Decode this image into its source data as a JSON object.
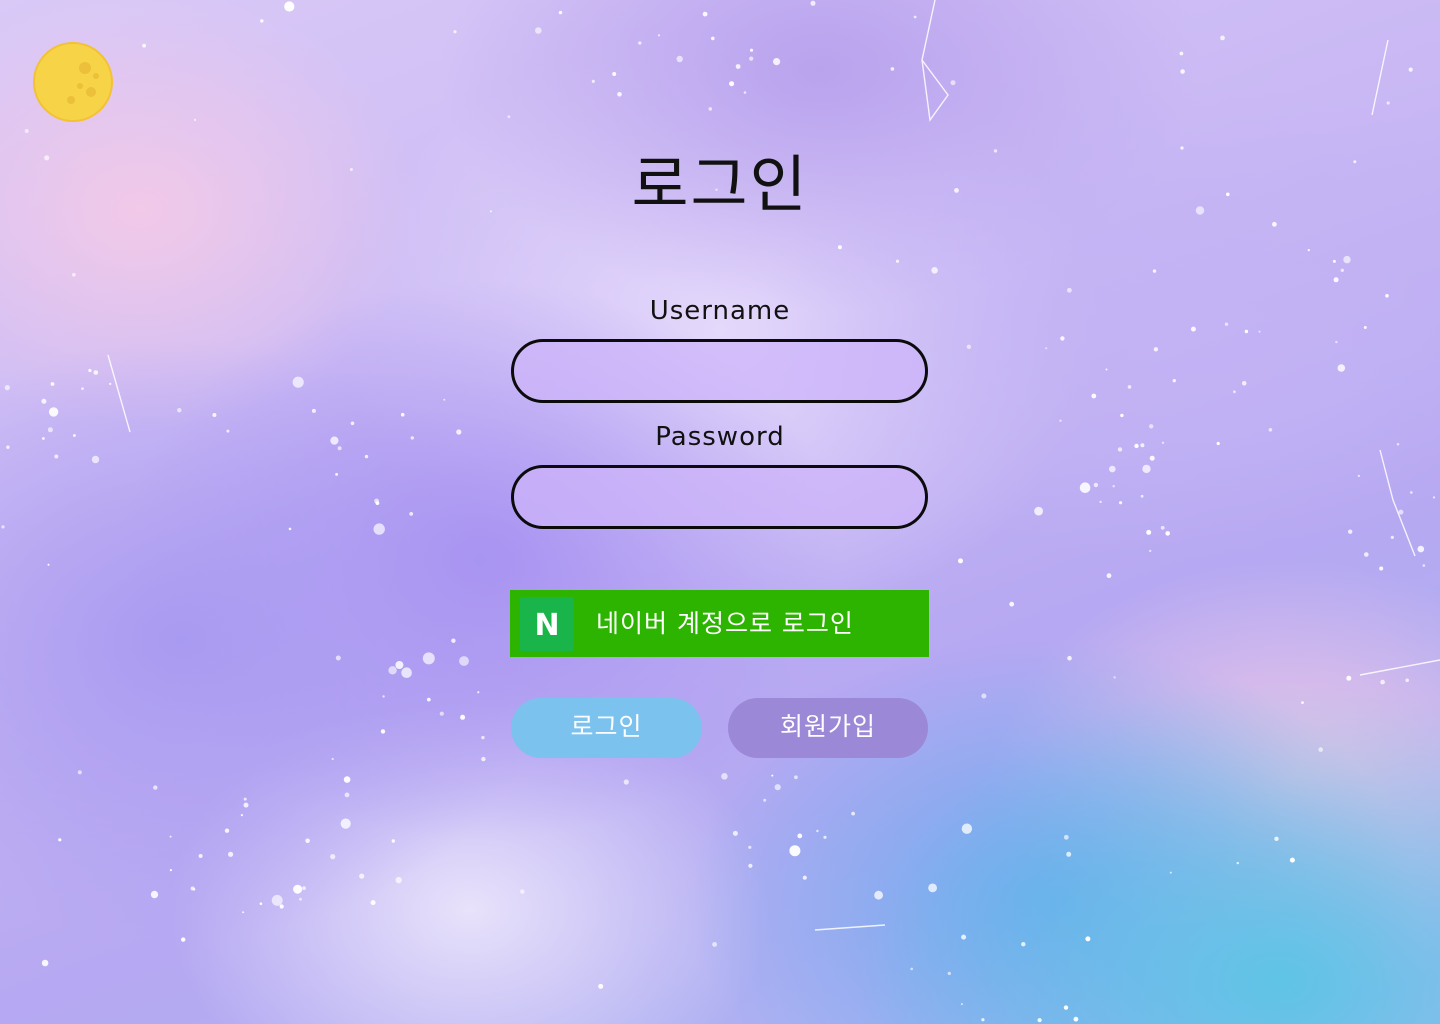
{
  "page": {
    "title": "로그인"
  },
  "form": {
    "username_label": "Username",
    "password_label": "Password",
    "username_value": "",
    "password_value": ""
  },
  "naver": {
    "logo_letter": "N",
    "label": "네이버 계정으로 로그인",
    "color": "#2db400"
  },
  "actions": {
    "login_label": "로그인",
    "signup_label": "회원가입",
    "login_color": "#7cc2ee",
    "signup_color": "#9b88d6"
  },
  "decor": {
    "moon_icon": "moon-icon",
    "background": "pastel-watercolor-galaxy"
  }
}
